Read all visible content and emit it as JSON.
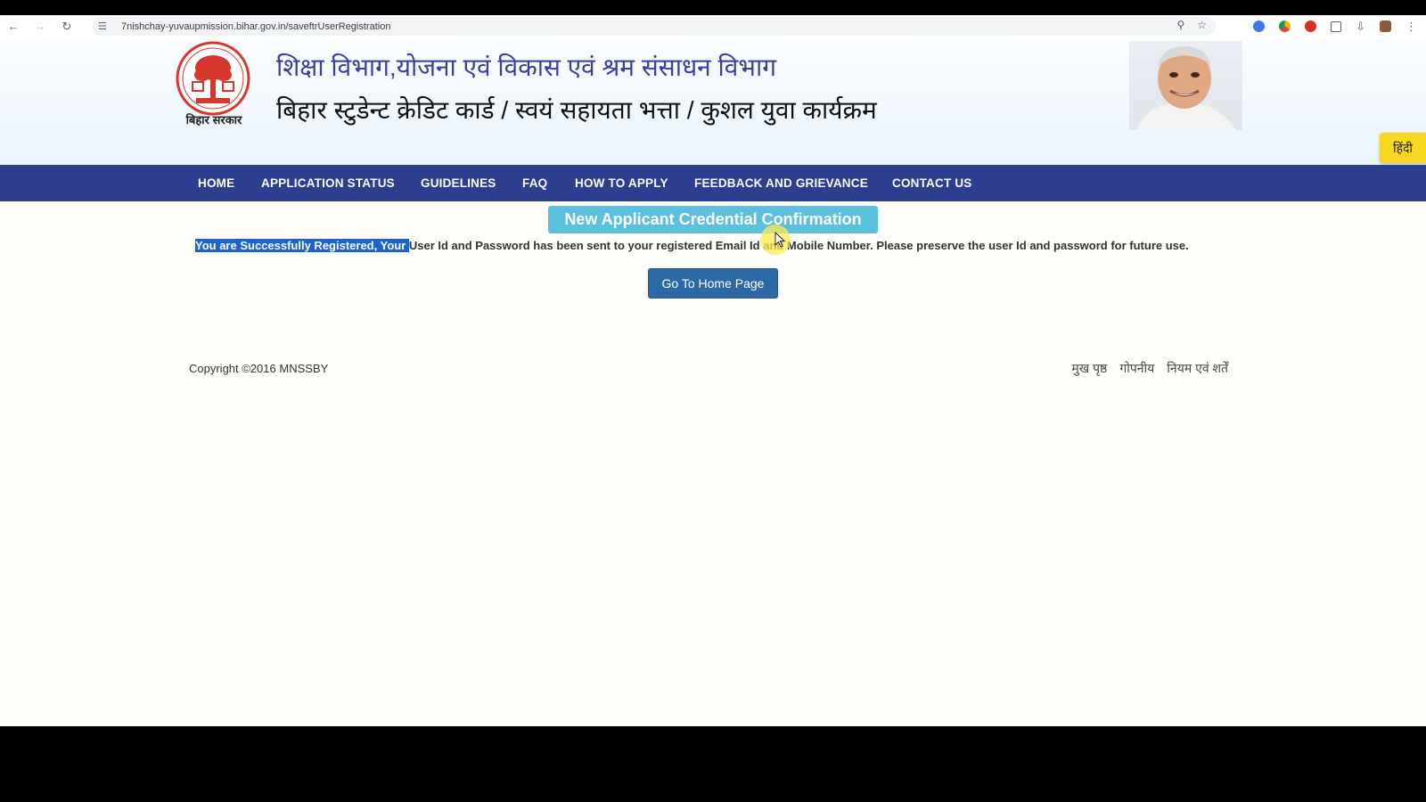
{
  "browser": {
    "url": "7nishchay-yuvaupmission.bihar.gov.in/saveftrUserRegistration"
  },
  "header": {
    "emblem_caption": "बिहार सरकार",
    "title_line1": "शिक्षा विभाग,योजना एवं विकास एवं श्रम संसाधन विभाग",
    "title_line2": "बिहार स्टुडेन्ट क्रेडिट कार्ड / स्वयं सहायता भत्ता / कुशल युवा कार्यक्रम",
    "language_toggle": "हिंदी"
  },
  "nav": {
    "items": [
      "HOME",
      "APPLICATION STATUS",
      "GUIDELINES",
      "FAQ",
      "HOW TO APPLY",
      "FEEDBACK AND GRIEVANCE",
      "CONTACT US"
    ]
  },
  "main": {
    "confirmation_title": "New Applicant Credential Confirmation",
    "message_selected": "You are Successfully Registered, Your ",
    "message_rest": "User Id and Password has been sent to your registered Email Id and Mobile Number. Please preserve the user Id and password for future use.",
    "home_button": "Go To Home Page"
  },
  "footer": {
    "copyright": "Copyright ©2016 MNSSBY",
    "links": [
      "मुख पृष्ठ",
      "गोपनीय",
      "नियम एवं शर्तें"
    ]
  },
  "colors": {
    "navbar": "#2c3f8f",
    "confirmation_bg": "#5bc0de",
    "button_bg": "#2d6aa5",
    "hindi_btn": "#f7d81e",
    "selection": "#1e62d0"
  }
}
